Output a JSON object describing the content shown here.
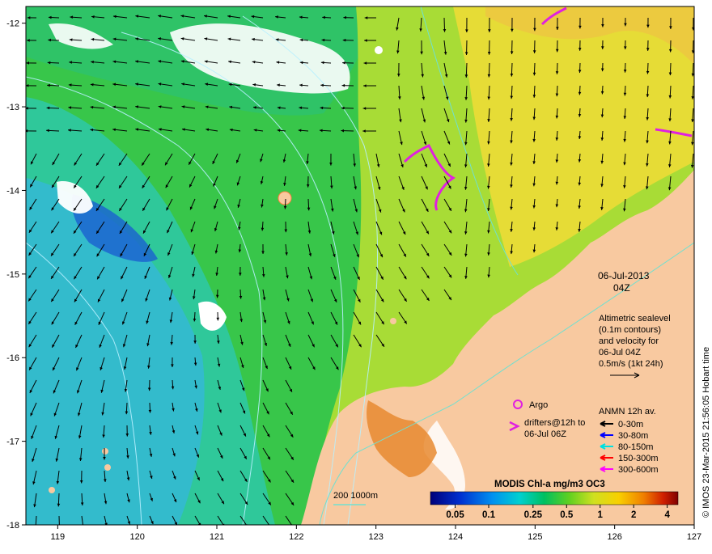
{
  "axes": {
    "x_ticks": [
      "119",
      "120",
      "121",
      "122",
      "123",
      "124",
      "125",
      "126",
      "127"
    ],
    "y_ticks": [
      "-12",
      "-13",
      "-14",
      "-15",
      "-16",
      "-17",
      "-18"
    ],
    "lon_range": [
      118.6,
      127.0
    ],
    "lat_range": [
      -18.0,
      -11.8
    ]
  },
  "info": {
    "date": "06-Jul-2013",
    "time": "04Z",
    "desc_lines": [
      "Altimetric sealevel",
      "(0.1m contours)",
      "and velocity for",
      "06-Jul 04Z"
    ],
    "scale_label": "0.5m/s (1kt 24h)"
  },
  "legend": {
    "argo": "Argo",
    "drifters_line1": "drifters@12h to",
    "drifters_line2": "06-Jul 06Z",
    "anmn_title": "ANMN 12h av.",
    "anmn_items": [
      {
        "label": "0-30m",
        "color": "#000000"
      },
      {
        "label": "30-80m",
        "color": "#0000ff"
      },
      {
        "label": "80-150m",
        "color": "#00e0e0"
      },
      {
        "label": "150-300m",
        "color": "#ff0000"
      },
      {
        "label": "300-600m",
        "color": "#ff00ff"
      }
    ],
    "isobath_label": "200 1000m"
  },
  "colorbar": {
    "title": "MODIS Chl-a mg/m3 OC3",
    "ticks": [
      "0.05",
      "0.1",
      "0.25",
      "0.5",
      "1",
      "2",
      "4"
    ]
  },
  "credit": "© IMOS 23-Mar-2015 21:56:05 Hobart time",
  "colors": {
    "land": "#f8c9a0",
    "chl_blue": "#3aa0e8",
    "chl_cyan": "#20d0c0",
    "chl_green": "#30c850",
    "chl_yellowgreen": "#a8e030",
    "chl_yellow": "#e8e030",
    "argo": "#e020e0"
  }
}
